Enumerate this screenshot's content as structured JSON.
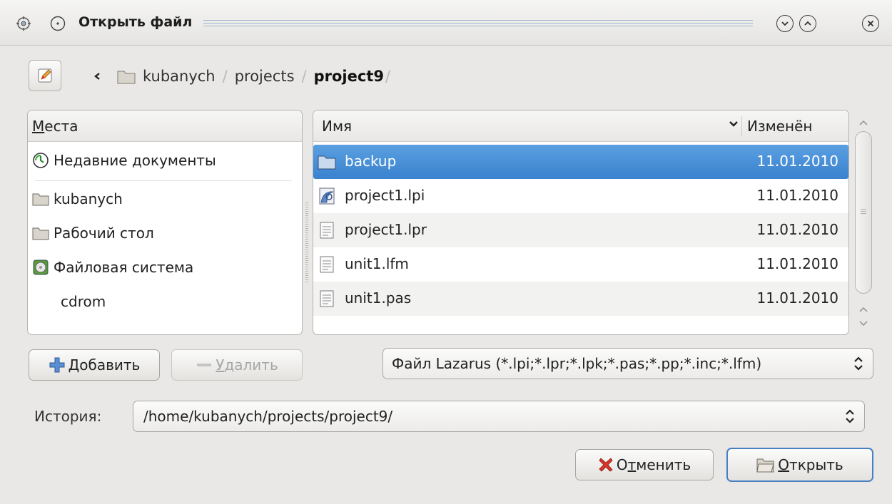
{
  "window": {
    "title": "Открыть файл"
  },
  "breadcrumb": {
    "items": [
      "kubanych",
      "projects"
    ],
    "current": "project9",
    "sep": "/"
  },
  "places": {
    "header": "Места",
    "header_rest": "еста",
    "header_key": "М",
    "items": [
      {
        "label": "Недавние документы",
        "icon": "recent-documents-icon"
      },
      {
        "label": "kubanych",
        "icon": "folder-icon"
      },
      {
        "label": "Рабочий стол",
        "icon": "folder-icon"
      },
      {
        "label": "Файловая система",
        "icon": "drive-icon"
      },
      {
        "label": "cdrom",
        "icon": "none"
      }
    ]
  },
  "files": {
    "columns": {
      "name": "Имя",
      "modified": "Изменён"
    },
    "rows": [
      {
        "name": "backup",
        "modified": "11.01.2010",
        "icon": "folder-icon",
        "selected": true
      },
      {
        "name": "project1.lpi",
        "modified": "11.01.2010",
        "icon": "lazarus-project-icon"
      },
      {
        "name": "project1.lpr",
        "modified": "11.01.2010",
        "icon": "text-file-icon"
      },
      {
        "name": "unit1.lfm",
        "modified": "11.01.2010",
        "icon": "text-file-icon"
      },
      {
        "name": "unit1.pas",
        "modified": "11.01.2010",
        "icon": "text-file-icon"
      }
    ]
  },
  "buttons": {
    "add": {
      "key": "Д",
      "rest": "обавить"
    },
    "remove": {
      "key": "У",
      "rest": "далить"
    },
    "cancel": {
      "pre": "О",
      "key": "т",
      "rest": "менить"
    },
    "open": {
      "key": "О",
      "rest": "ткрыть"
    }
  },
  "filter": {
    "value": "Файл Lazarus (*.lpi;*.lpr;*.lpk;*.pas;*.pp;*.inc;*.lfm)"
  },
  "history": {
    "label": "История:",
    "value": "/home/kubanych/projects/project9/"
  },
  "colors": {
    "selection": "#3a82cf",
    "background": "#e9e8e6"
  }
}
